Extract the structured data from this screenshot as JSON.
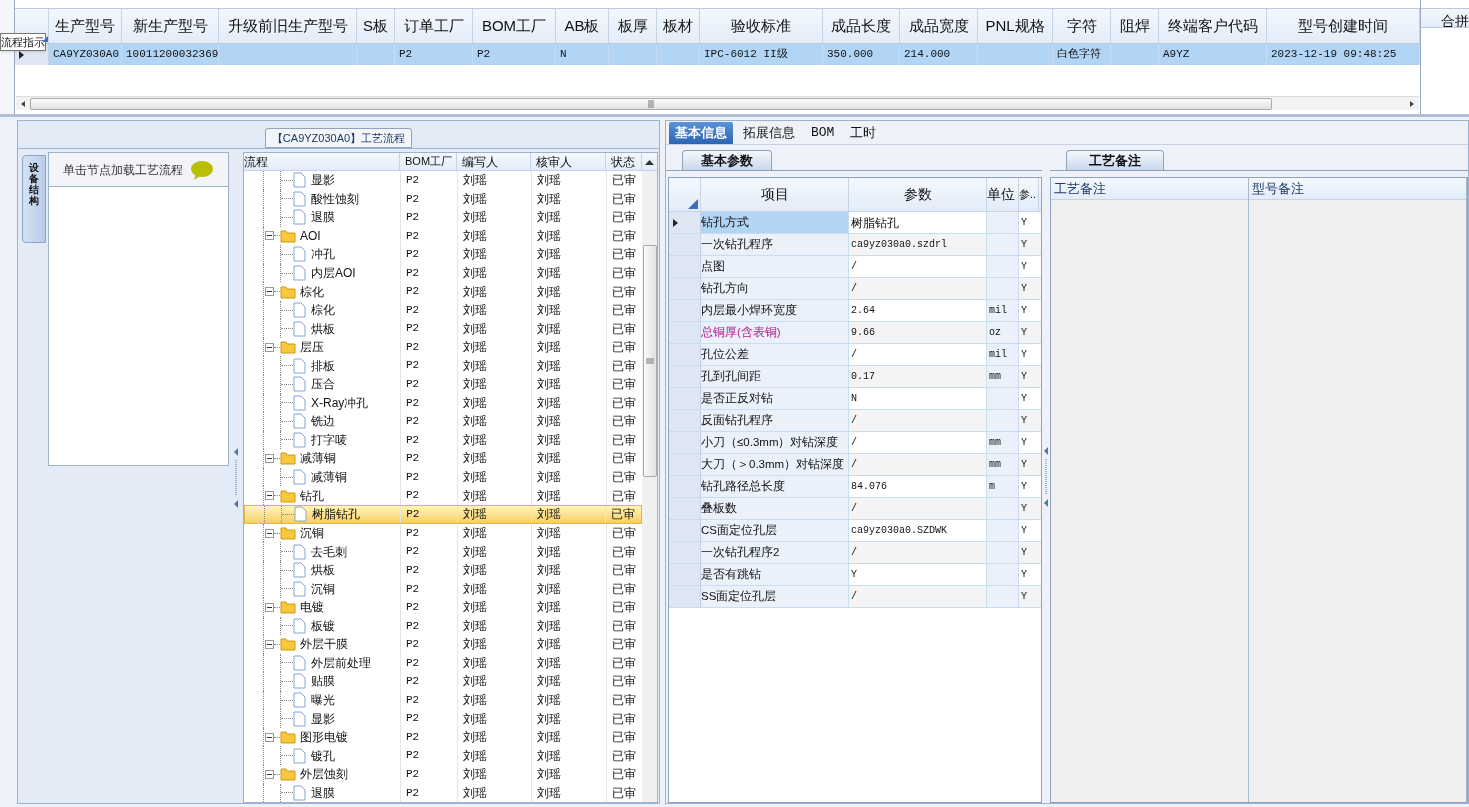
{
  "tooltip": "流程指示",
  "top_grid": {
    "columns": [
      "生产型号",
      "新生产型号",
      "升级前旧生产型号",
      "S板",
      "订单工厂",
      "BOM工厂",
      "AB板",
      "板厚",
      "板材",
      "验收标准",
      "成品长度",
      "成品宽度",
      "PNL规格",
      "字符",
      "阻焊",
      "终端客户代码",
      "型号创建时间"
    ],
    "rows": [
      {
        "selected": true,
        "cells": [
          "CA9YZ030A0",
          "10011200032369",
          null,
          null,
          "P2",
          "P2",
          "N",
          null,
          null,
          "IPC-6012 II级",
          "350.000",
          "214.000",
          null,
          "白色字符",
          null,
          "A9YZ",
          "2023-12-19 09:48:25"
        ]
      }
    ],
    "side_column": "合拼"
  },
  "process_panel": {
    "title": "【CA9YZ030A0】工艺流程",
    "side_tab": "设备结构",
    "hint": "单击节点加载工艺流程",
    "columns": [
      "流程",
      "BOM工厂",
      "编写人",
      "核审人",
      "状态"
    ],
    "tree": [
      {
        "kind": "step",
        "name": "显影",
        "bom": "P2",
        "writer": "刘瑶",
        "reviewer": "刘瑶",
        "status": "已审",
        "selected": false
      },
      {
        "kind": "step",
        "name": "酸性蚀刻",
        "bom": "P2",
        "writer": "刘瑶",
        "reviewer": "刘瑶",
        "status": "已审",
        "selected": false
      },
      {
        "kind": "step",
        "name": "退膜",
        "bom": "P2",
        "writer": "刘瑶",
        "reviewer": "刘瑶",
        "status": "已审",
        "selected": false
      },
      {
        "kind": "group",
        "name": "AOI",
        "bom": "P2",
        "writer": "刘瑶",
        "reviewer": "刘瑶",
        "status": "已审",
        "selected": false,
        "expanded": true,
        "children": [
          {
            "kind": "step",
            "name": "冲孔",
            "bom": "P2",
            "writer": "刘瑶",
            "reviewer": "刘瑶",
            "status": "已审",
            "selected": false
          },
          {
            "kind": "step",
            "name": "内层AOI",
            "bom": "P2",
            "writer": "刘瑶",
            "reviewer": "刘瑶",
            "status": "已审",
            "selected": false
          }
        ]
      },
      {
        "kind": "group",
        "name": "棕化",
        "bom": "P2",
        "writer": "刘瑶",
        "reviewer": "刘瑶",
        "status": "已审",
        "selected": false,
        "expanded": true,
        "children": [
          {
            "kind": "step",
            "name": "棕化",
            "bom": "P2",
            "writer": "刘瑶",
            "reviewer": "刘瑶",
            "status": "已审",
            "selected": false
          },
          {
            "kind": "step",
            "name": "烘板",
            "bom": "P2",
            "writer": "刘瑶",
            "reviewer": "刘瑶",
            "status": "已审",
            "selected": false
          }
        ]
      },
      {
        "kind": "group",
        "name": "层压",
        "bom": "P2",
        "writer": "刘瑶",
        "reviewer": "刘瑶",
        "status": "已审",
        "selected": false,
        "expanded": true,
        "children": [
          {
            "kind": "step",
            "name": "排板",
            "bom": "P2",
            "writer": "刘瑶",
            "reviewer": "刘瑶",
            "status": "已审",
            "selected": false
          },
          {
            "kind": "step",
            "name": "压合",
            "bom": "P2",
            "writer": "刘瑶",
            "reviewer": "刘瑶",
            "status": "已审",
            "selected": false
          },
          {
            "kind": "step",
            "name": "X-Ray冲孔",
            "bom": "P2",
            "writer": "刘瑶",
            "reviewer": "刘瑶",
            "status": "已审",
            "selected": false
          },
          {
            "kind": "step",
            "name": "铣边",
            "bom": "P2",
            "writer": "刘瑶",
            "reviewer": "刘瑶",
            "status": "已审",
            "selected": false
          },
          {
            "kind": "step",
            "name": "打字唛",
            "bom": "P2",
            "writer": "刘瑶",
            "reviewer": "刘瑶",
            "status": "已审",
            "selected": false
          }
        ]
      },
      {
        "kind": "group",
        "name": "减薄铜",
        "bom": "P2",
        "writer": "刘瑶",
        "reviewer": "刘瑶",
        "status": "已审",
        "selected": false,
        "expanded": true,
        "children": [
          {
            "kind": "step",
            "name": "减薄铜",
            "bom": "P2",
            "writer": "刘瑶",
            "reviewer": "刘瑶",
            "status": "已审",
            "selected": false
          }
        ]
      },
      {
        "kind": "group",
        "name": "钻孔",
        "bom": "P2",
        "writer": "刘瑶",
        "reviewer": "刘瑶",
        "status": "已审",
        "selected": false,
        "expanded": true,
        "children": [
          {
            "kind": "step",
            "name": "树脂钻孔",
            "bom": "P2",
            "writer": "刘瑶",
            "reviewer": "刘瑶",
            "status": "已审",
            "selected": true
          }
        ]
      },
      {
        "kind": "group",
        "name": "沉铜",
        "bom": "P2",
        "writer": "刘瑶",
        "reviewer": "刘瑶",
        "status": "已审",
        "selected": false,
        "expanded": true,
        "children": [
          {
            "kind": "step",
            "name": "去毛刺",
            "bom": "P2",
            "writer": "刘瑶",
            "reviewer": "刘瑶",
            "status": "已审",
            "selected": false
          },
          {
            "kind": "step",
            "name": "烘板",
            "bom": "P2",
            "writer": "刘瑶",
            "reviewer": "刘瑶",
            "status": "已审",
            "selected": false
          },
          {
            "kind": "step",
            "name": "沉铜",
            "bom": "P2",
            "writer": "刘瑶",
            "reviewer": "刘瑶",
            "status": "已审",
            "selected": false
          }
        ]
      },
      {
        "kind": "group",
        "name": "电镀",
        "bom": "P2",
        "writer": "刘瑶",
        "reviewer": "刘瑶",
        "status": "已审",
        "selected": false,
        "expanded": true,
        "children": [
          {
            "kind": "step",
            "name": "板镀",
            "bom": "P2",
            "writer": "刘瑶",
            "reviewer": "刘瑶",
            "status": "已审",
            "selected": false
          }
        ]
      },
      {
        "kind": "group",
        "name": "外层干膜",
        "bom": "P2",
        "writer": "刘瑶",
        "reviewer": "刘瑶",
        "status": "已审",
        "selected": false,
        "expanded": true,
        "children": [
          {
            "kind": "step",
            "name": "外层前处理",
            "bom": "P2",
            "writer": "刘瑶",
            "reviewer": "刘瑶",
            "status": "已审",
            "selected": false
          },
          {
            "kind": "step",
            "name": "贴膜",
            "bom": "P2",
            "writer": "刘瑶",
            "reviewer": "刘瑶",
            "status": "已审",
            "selected": false
          },
          {
            "kind": "step",
            "name": "曝光",
            "bom": "P2",
            "writer": "刘瑶",
            "reviewer": "刘瑶",
            "status": "已审",
            "selected": false
          },
          {
            "kind": "step",
            "name": "显影",
            "bom": "P2",
            "writer": "刘瑶",
            "reviewer": "刘瑶",
            "status": "已审",
            "selected": false
          }
        ]
      },
      {
        "kind": "group",
        "name": "图形电镀",
        "bom": "P2",
        "writer": "刘瑶",
        "reviewer": "刘瑶",
        "status": "已审",
        "selected": false,
        "expanded": true,
        "children": [
          {
            "kind": "step",
            "name": "镀孔",
            "bom": "P2",
            "writer": "刘瑶",
            "reviewer": "刘瑶",
            "status": "已审",
            "selected": false
          }
        ]
      },
      {
        "kind": "group",
        "name": "外层蚀刻",
        "bom": "P2",
        "writer": "刘瑶",
        "reviewer": "刘瑶",
        "status": "已审",
        "selected": false,
        "expanded": true,
        "children": [
          {
            "kind": "step",
            "name": "退膜",
            "bom": "P2",
            "writer": "刘瑶",
            "reviewer": "刘瑶",
            "status": "已审",
            "selected": false
          }
        ]
      }
    ]
  },
  "detail_tabs": [
    {
      "label": "基本信息",
      "selected": true
    },
    {
      "label": "拓展信息",
      "selected": false
    },
    {
      "label": "BOM",
      "selected": false
    },
    {
      "label": "工时",
      "selected": false
    }
  ],
  "params": {
    "tab": "基本参数",
    "columns": [
      "项目",
      "参数",
      "单位",
      "参.."
    ],
    "rows": [
      {
        "item": "钻孔方式",
        "value": "树脂钻孔",
        "flag": "Y",
        "selected": true,
        "emphasized": false
      },
      {
        "item": "一次钻孔程序",
        "value": "ca9yz030a0.szdrl",
        "flag": "Y",
        "selected": false,
        "emphasized": false
      },
      {
        "item": "点图",
        "value": "/",
        "flag": "Y",
        "selected": false,
        "emphasized": false
      },
      {
        "item": "钻孔方向",
        "value": "/",
        "flag": "Y",
        "selected": false,
        "emphasized": false
      },
      {
        "item": "内层最小焊环宽度",
        "value": "2.64",
        "unit": "mil",
        "flag": "Y",
        "selected": false,
        "emphasized": false
      },
      {
        "item": "总铜厚(含表铜)",
        "value": "9.66",
        "unit": "oz",
        "flag": "Y",
        "selected": false,
        "emphasized": true
      },
      {
        "item": "孔位公差",
        "value": "/",
        "unit": "mil",
        "flag": "Y",
        "selected": false,
        "emphasized": false
      },
      {
        "item": "孔到孔间距",
        "value": "0.17",
        "unit": "mm",
        "flag": "Y",
        "selected": false,
        "emphasized": false
      },
      {
        "item": "是否正反对钻",
        "value": "N",
        "flag": "Y",
        "selected": false,
        "emphasized": false
      },
      {
        "item": "反面钻孔程序",
        "value": "/",
        "flag": "Y",
        "selected": false,
        "emphasized": false
      },
      {
        "item": "小刀（≤0.3mm）对钻深度",
        "value": "/",
        "unit": "mm",
        "flag": "Y",
        "selected": false,
        "emphasized": false
      },
      {
        "item": "大刀（＞0.3mm）对钻深度",
        "value": "/",
        "unit": "mm",
        "flag": "Y",
        "selected": false,
        "emphasized": false
      },
      {
        "item": "钻孔路径总长度",
        "value": "84.076",
        "unit": "m",
        "flag": "Y",
        "selected": false,
        "emphasized": false
      },
      {
        "item": "叠板数",
        "value": "/",
        "flag": "Y",
        "selected": false,
        "emphasized": false
      },
      {
        "item": "CS面定位孔层",
        "value": "ca9yz030a0.SZDWK",
        "flag": "Y",
        "selected": false,
        "emphasized": false
      },
      {
        "item": "一次钻孔程序2",
        "value": "/",
        "flag": "Y",
        "selected": false,
        "emphasized": false
      },
      {
        "item": "是否有跳钻",
        "value": "Y",
        "flag": "Y",
        "selected": false,
        "emphasized": false
      },
      {
        "item": "SS面定位孔层",
        "value": "/",
        "flag": "Y",
        "selected": false,
        "emphasized": false
      }
    ]
  },
  "notes": {
    "tab": "工艺备注",
    "columns": [
      "工艺备注",
      "型号备注"
    ]
  }
}
